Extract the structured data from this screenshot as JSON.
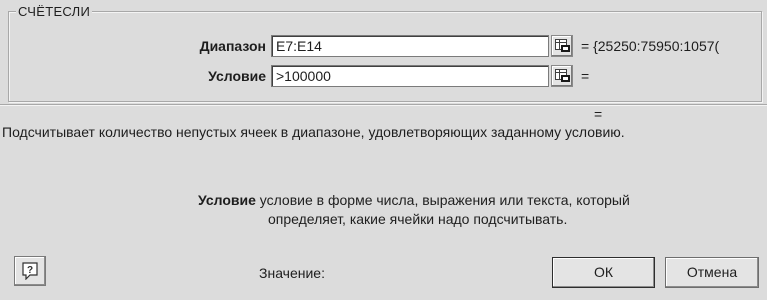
{
  "dialog": {
    "function_name": "СЧЁТЕСЛИ"
  },
  "args": {
    "range": {
      "label": "Диапазон",
      "value": "E7:E14",
      "result": "= {25250:75950:1057("
    },
    "criteria": {
      "label": "Условие",
      "value": ">100000",
      "result": "="
    }
  },
  "formula_result": "=",
  "description": "Подсчитывает количество непустых ячеек в диапазоне, удовлетворяющих заданному условию.",
  "arg_help": {
    "name": "Условие",
    "line1": " условие в форме числа, выражения или текста, который",
    "line2": "определяет, какие ячейки надо подсчитывать."
  },
  "footer": {
    "value_label": "Значение:",
    "ok_label": "ОК",
    "cancel_label": "Отмена"
  },
  "icons": {
    "help": "help-icon",
    "collapse": "collapse-dialog-icon"
  }
}
